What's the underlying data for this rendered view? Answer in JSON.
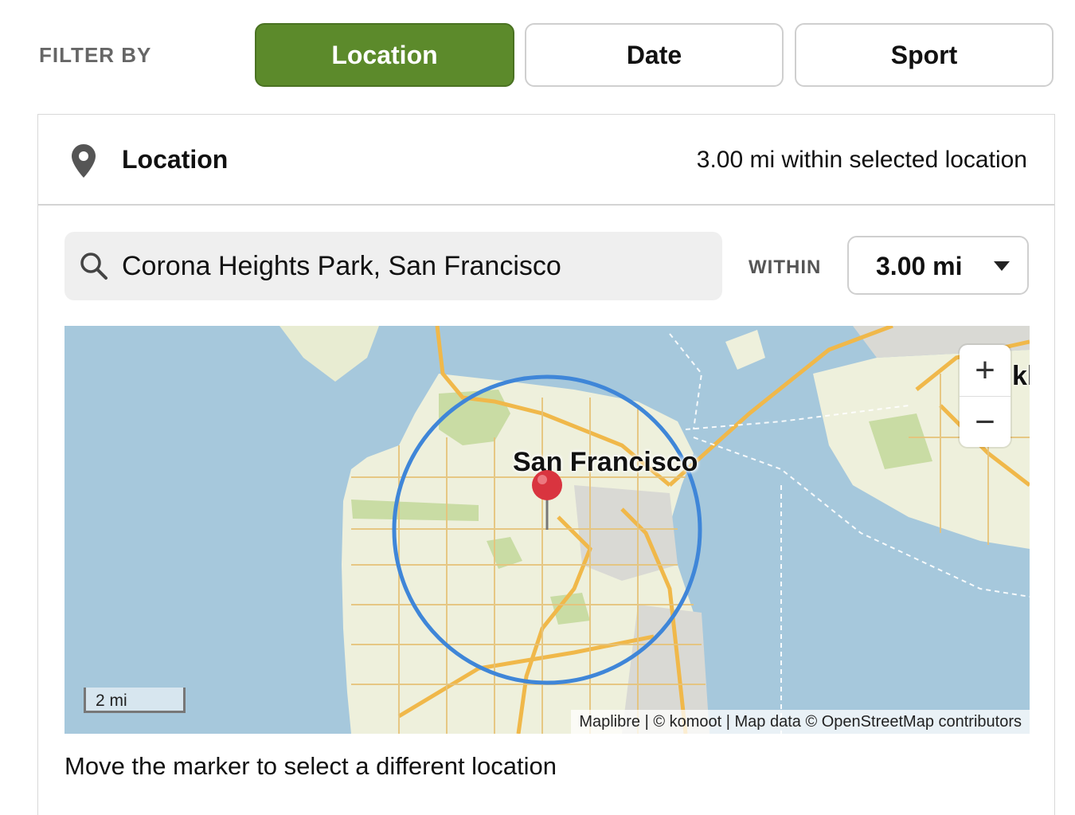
{
  "filter": {
    "label": "FILTER BY",
    "tabs": [
      {
        "label": "Location",
        "active": true
      },
      {
        "label": "Date",
        "active": false
      },
      {
        "label": "Sport",
        "active": false
      }
    ]
  },
  "panel": {
    "title": "Location",
    "summary": "3.00 mi within selected location",
    "icon": "map-pin-icon"
  },
  "search": {
    "value": "Corona Heights Park, San Francisco",
    "icon": "search-icon"
  },
  "radius": {
    "label": "WITHIN",
    "value": "3.00 mi"
  },
  "map": {
    "city_label": "San Francisco",
    "partial_label": "kla",
    "scale_label": "2 mi",
    "zoom_in": "+",
    "zoom_out": "−",
    "attribution": "Maplibre | © komoot | Map data © OpenStreetMap contributors",
    "colors": {
      "water": "#a6c8dc",
      "land": "#eef0dc",
      "park": "#c9dca4",
      "road": "#f0b84a",
      "radius_circle": "#3f86d8",
      "marker": "#d9343f"
    }
  },
  "hint": "Move the marker to select a different location",
  "colors": {
    "active_tab": "#5c8a2b"
  }
}
